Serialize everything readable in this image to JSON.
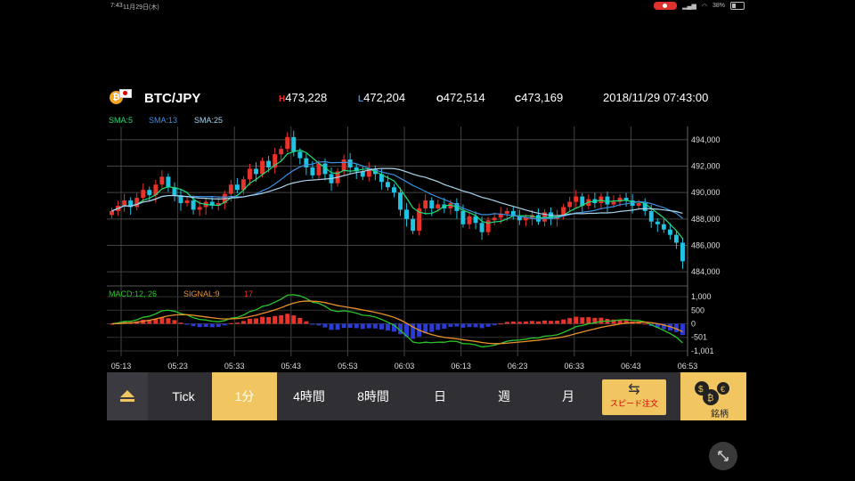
{
  "status_bar": {
    "time": "7:43",
    "date": "11月29日(木)",
    "battery": "38%"
  },
  "header": {
    "pair": "BTC/JPY",
    "high_prefix": "H",
    "high": "473,228",
    "low_prefix": "L",
    "low": "472,204",
    "open_prefix": "O",
    "open": "472,514",
    "close_prefix": "C",
    "close": "473,169",
    "datetime": "2018/11/29 07:43:00"
  },
  "indicators": {
    "sma5": "SMA:5",
    "sma13": "SMA:13",
    "sma25": "SMA:25",
    "macd": "MACD:12, 26",
    "signal": "SIGNAL:9",
    "third": "17"
  },
  "colors": {
    "up": "#e8322a",
    "down": "#1fc3e3",
    "sma5": "#19e07a",
    "sma13": "#3d8fe0",
    "sma25": "#a9d6ee",
    "macd": "#28c62a",
    "signal": "#e7912b",
    "hist_up": "#e8322a",
    "hist_down": "#2a3bd8",
    "accent": "#f1c660"
  },
  "chart_data": {
    "type": "candlestick",
    "x_ticks": [
      "05:13",
      "05:23",
      "05:33",
      "05:43",
      "05:53",
      "06:03",
      "06:13",
      "06:23",
      "06:33",
      "06:43",
      "06:53"
    ],
    "price_axis": [
      "494,000",
      "492,000",
      "490,000",
      "488,000",
      "486,000",
      "484,000"
    ],
    "price_range": [
      483200,
      495000
    ],
    "close": [
      488600,
      489000,
      489400,
      488900,
      489600,
      490200,
      489800,
      490600,
      491200,
      490400,
      489800,
      489200,
      489400,
      488700,
      488900,
      489300,
      489000,
      489200,
      489900,
      490600,
      490200,
      491000,
      491800,
      491400,
      492400,
      491900,
      492900,
      493300,
      494200,
      493100,
      492600,
      491900,
      491300,
      492200,
      491400,
      490700,
      491600,
      492500,
      491900,
      491600,
      491200,
      491800,
      491400,
      490800,
      490400,
      490000,
      488700,
      488000,
      487100,
      488800,
      489400,
      488800,
      489100,
      488800,
      489200,
      488600,
      487600,
      488200,
      487700,
      487000,
      487900,
      488100,
      488400,
      488600,
      488200,
      487900,
      488100,
      488300,
      487800,
      488500,
      488000,
      488200,
      488900,
      489300,
      489700,
      489000,
      489500,
      489200,
      489700,
      489100,
      489300,
      489600,
      489400,
      489000,
      489200,
      488600,
      487800,
      487600,
      487200,
      486800,
      486200,
      484800
    ]
  },
  "macd_axis": [
    "1,000",
    "500",
    "0",
    "-501",
    "-1,001"
  ],
  "macd_range": [
    -1200,
    1200
  ],
  "toolbar": {
    "tabs": [
      "Tick",
      "1分",
      "4時間",
      "8時間",
      "日",
      "週",
      "月"
    ],
    "active": "1分",
    "speed_order": "スピード注文",
    "meigara": "銘柄"
  }
}
